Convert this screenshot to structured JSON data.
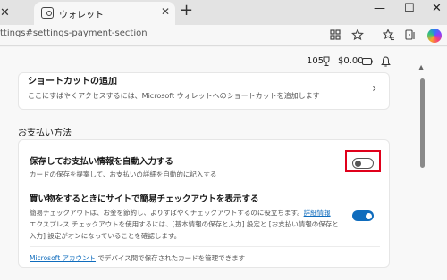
{
  "browser": {
    "prev_tab_close": "✕",
    "active_tab": {
      "title": "ウォレット",
      "close": "✕"
    },
    "new_tab": "+",
    "window_controls": {
      "minimize": "—",
      "maximize": "☐",
      "close": "✕"
    },
    "url": "ttings#settings-payment-section",
    "icons": [
      "apps-icon",
      "favorite-star-icon",
      "favorites-icon",
      "collections-icon",
      "copilot-icon"
    ]
  },
  "wallet_header": {
    "rewards_points": "105",
    "cash_amount": "$0.00"
  },
  "shortcut_card": {
    "title": "ショートカットの追加",
    "description": "ここにすばやくアクセスするには、Microsoft ウォレットへのショートカットを追加します",
    "chevron": "›"
  },
  "payment_section": {
    "title": "お支払い方法",
    "autofill": {
      "title": "保存してお支払い情報を自動入力する",
      "description": "カードの保存を提案して、お支払いの詳細を自動的に記入する",
      "enabled": false
    },
    "express_checkout": {
      "title": "買い物をするときにサイトで簡易チェックアウトを表示する",
      "line1": "簡易チェックアウトは、お金を節約し、よりすばやくチェックアウトするのに役立ちます。",
      "details_link": "詳細情報",
      "line2": "エクスプレス チェックアウトを使用するには、[基本情報の保存と入力] 設定と [お支払い情報の保存と",
      "line3": "入力] 設定がオンになっていることを確認します。",
      "enabled": true
    },
    "footer_link": "Microsoft アカウント",
    "footer_text": " でデバイス間で保存されたカードを管理できます"
  },
  "colors": {
    "accent": "#0f6cbd",
    "highlight": "#e0001b"
  }
}
